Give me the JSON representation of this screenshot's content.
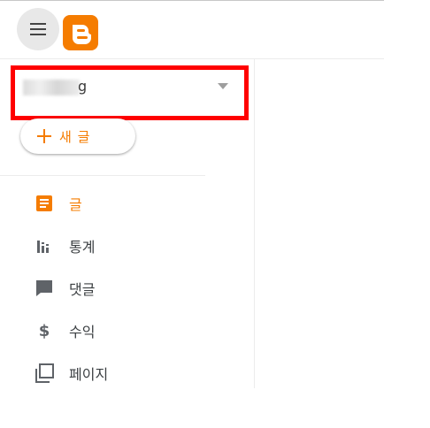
{
  "header": {
    "menu_icon": "hamburger-menu-icon",
    "logo_icon": "blogger-logo-icon",
    "brand_color": "#f57c00"
  },
  "blog_selector": {
    "blog_name": "g",
    "dropdown_icon": "caret-down-icon"
  },
  "new_post": {
    "label": "새 글",
    "icon": "plus-icon"
  },
  "nav": {
    "items": [
      {
        "label": "글",
        "icon": "posts-icon",
        "active": true
      },
      {
        "label": "통계",
        "icon": "stats-icon",
        "active": false
      },
      {
        "label": "댓글",
        "icon": "comment-icon",
        "active": false
      },
      {
        "label": "수익",
        "icon": "dollar-icon",
        "active": false
      },
      {
        "label": "페이지",
        "icon": "pages-icon",
        "active": false
      }
    ]
  },
  "colors": {
    "accent": "#f57c00",
    "icon_gray": "#5f6368",
    "highlight": "#ff0000"
  }
}
